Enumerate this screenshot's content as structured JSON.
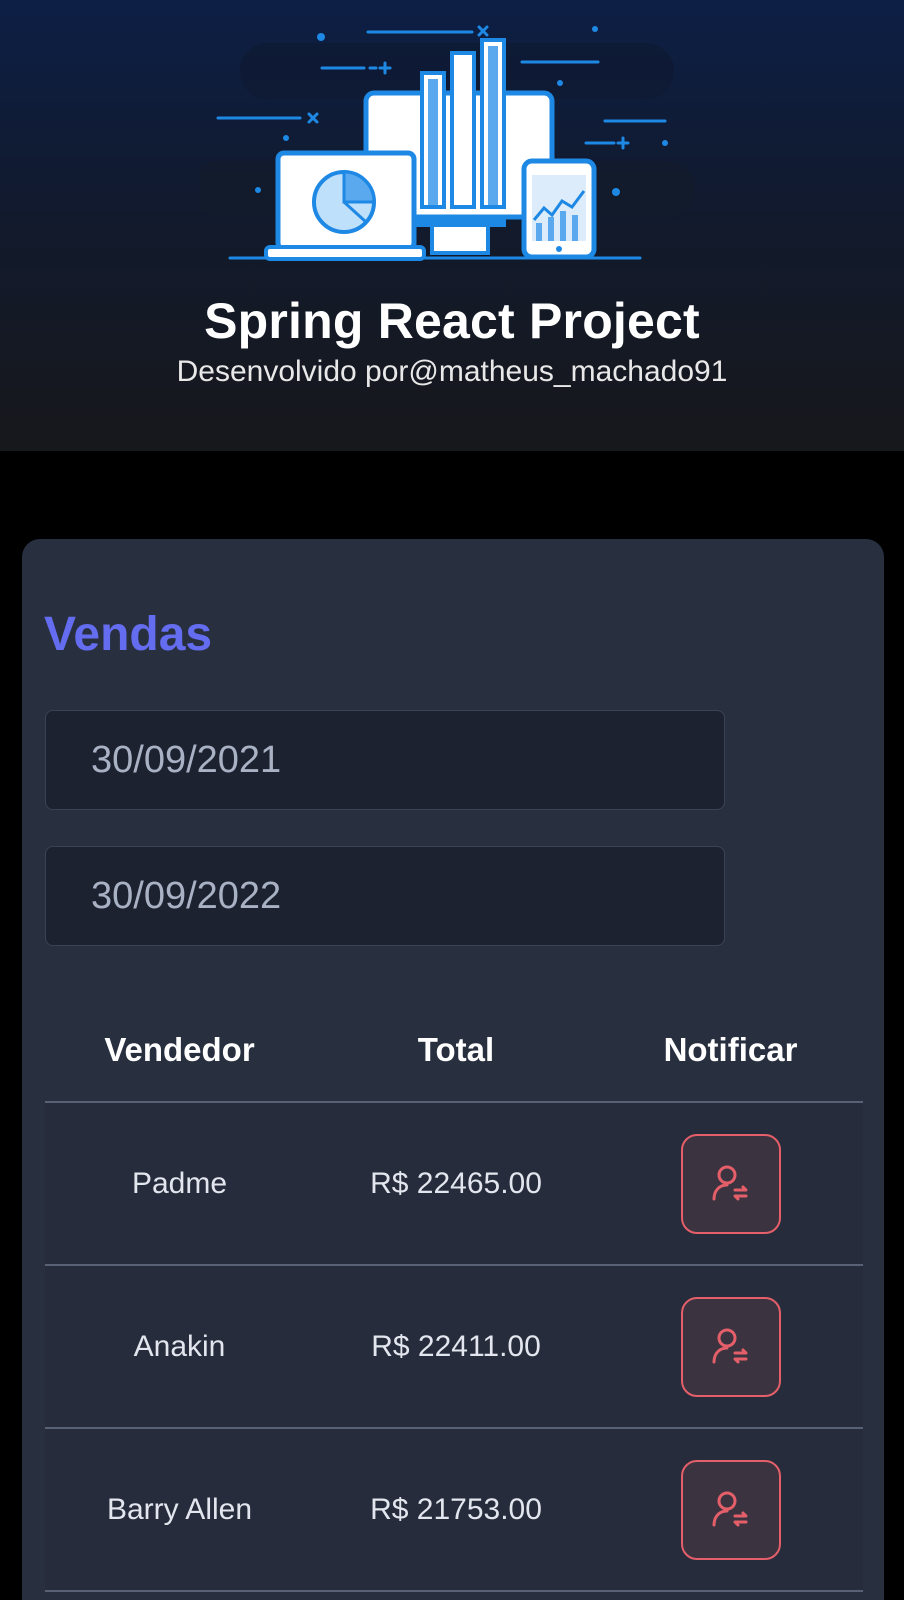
{
  "header": {
    "title": "Spring React Project",
    "subtitle": "Desenvolvido por@matheus_machado91",
    "illustration_icon": "dashboard-devices-illustration"
  },
  "card": {
    "title": "Vendas",
    "start_date": "30/09/2021",
    "end_date": "30/09/2022"
  },
  "table": {
    "columns": [
      "Vendedor",
      "Total",
      "Notificar"
    ],
    "rows": [
      {
        "seller": "Padme",
        "total": "R$ 22465.00"
      },
      {
        "seller": "Anakin",
        "total": "R$ 22411.00"
      },
      {
        "seller": "Barry Allen",
        "total": "R$ 21753.00"
      }
    ],
    "notify_icon": "user-notify-icon"
  },
  "colors": {
    "accent": "#646cf0",
    "notify": "#e45f69",
    "card_bg": "#283040",
    "input_bg": "#1c2230"
  }
}
